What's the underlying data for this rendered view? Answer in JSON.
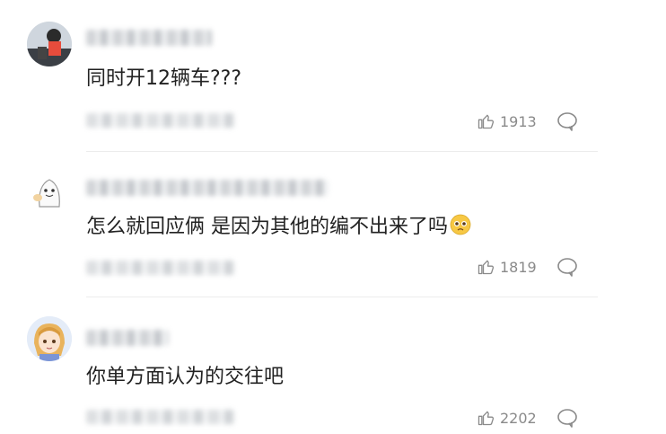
{
  "comments": [
    {
      "text": "同时开12辆车???",
      "likes": "1913",
      "avatar": "avatar-kid-icon"
    },
    {
      "text": "怎么就回应俩 是因为其他的编不出来了吗",
      "likes": "1819",
      "avatar": "avatar-cartoon-ghost-icon",
      "emoji": "pleading-face-icon"
    },
    {
      "text": "你单方面认为的交往吧",
      "likes": "2202",
      "avatar": "avatar-anime-girl-icon"
    }
  ],
  "colors": {
    "meta_text": "#8a8a8a",
    "divider": "#ececec",
    "body_text": "#222222"
  }
}
